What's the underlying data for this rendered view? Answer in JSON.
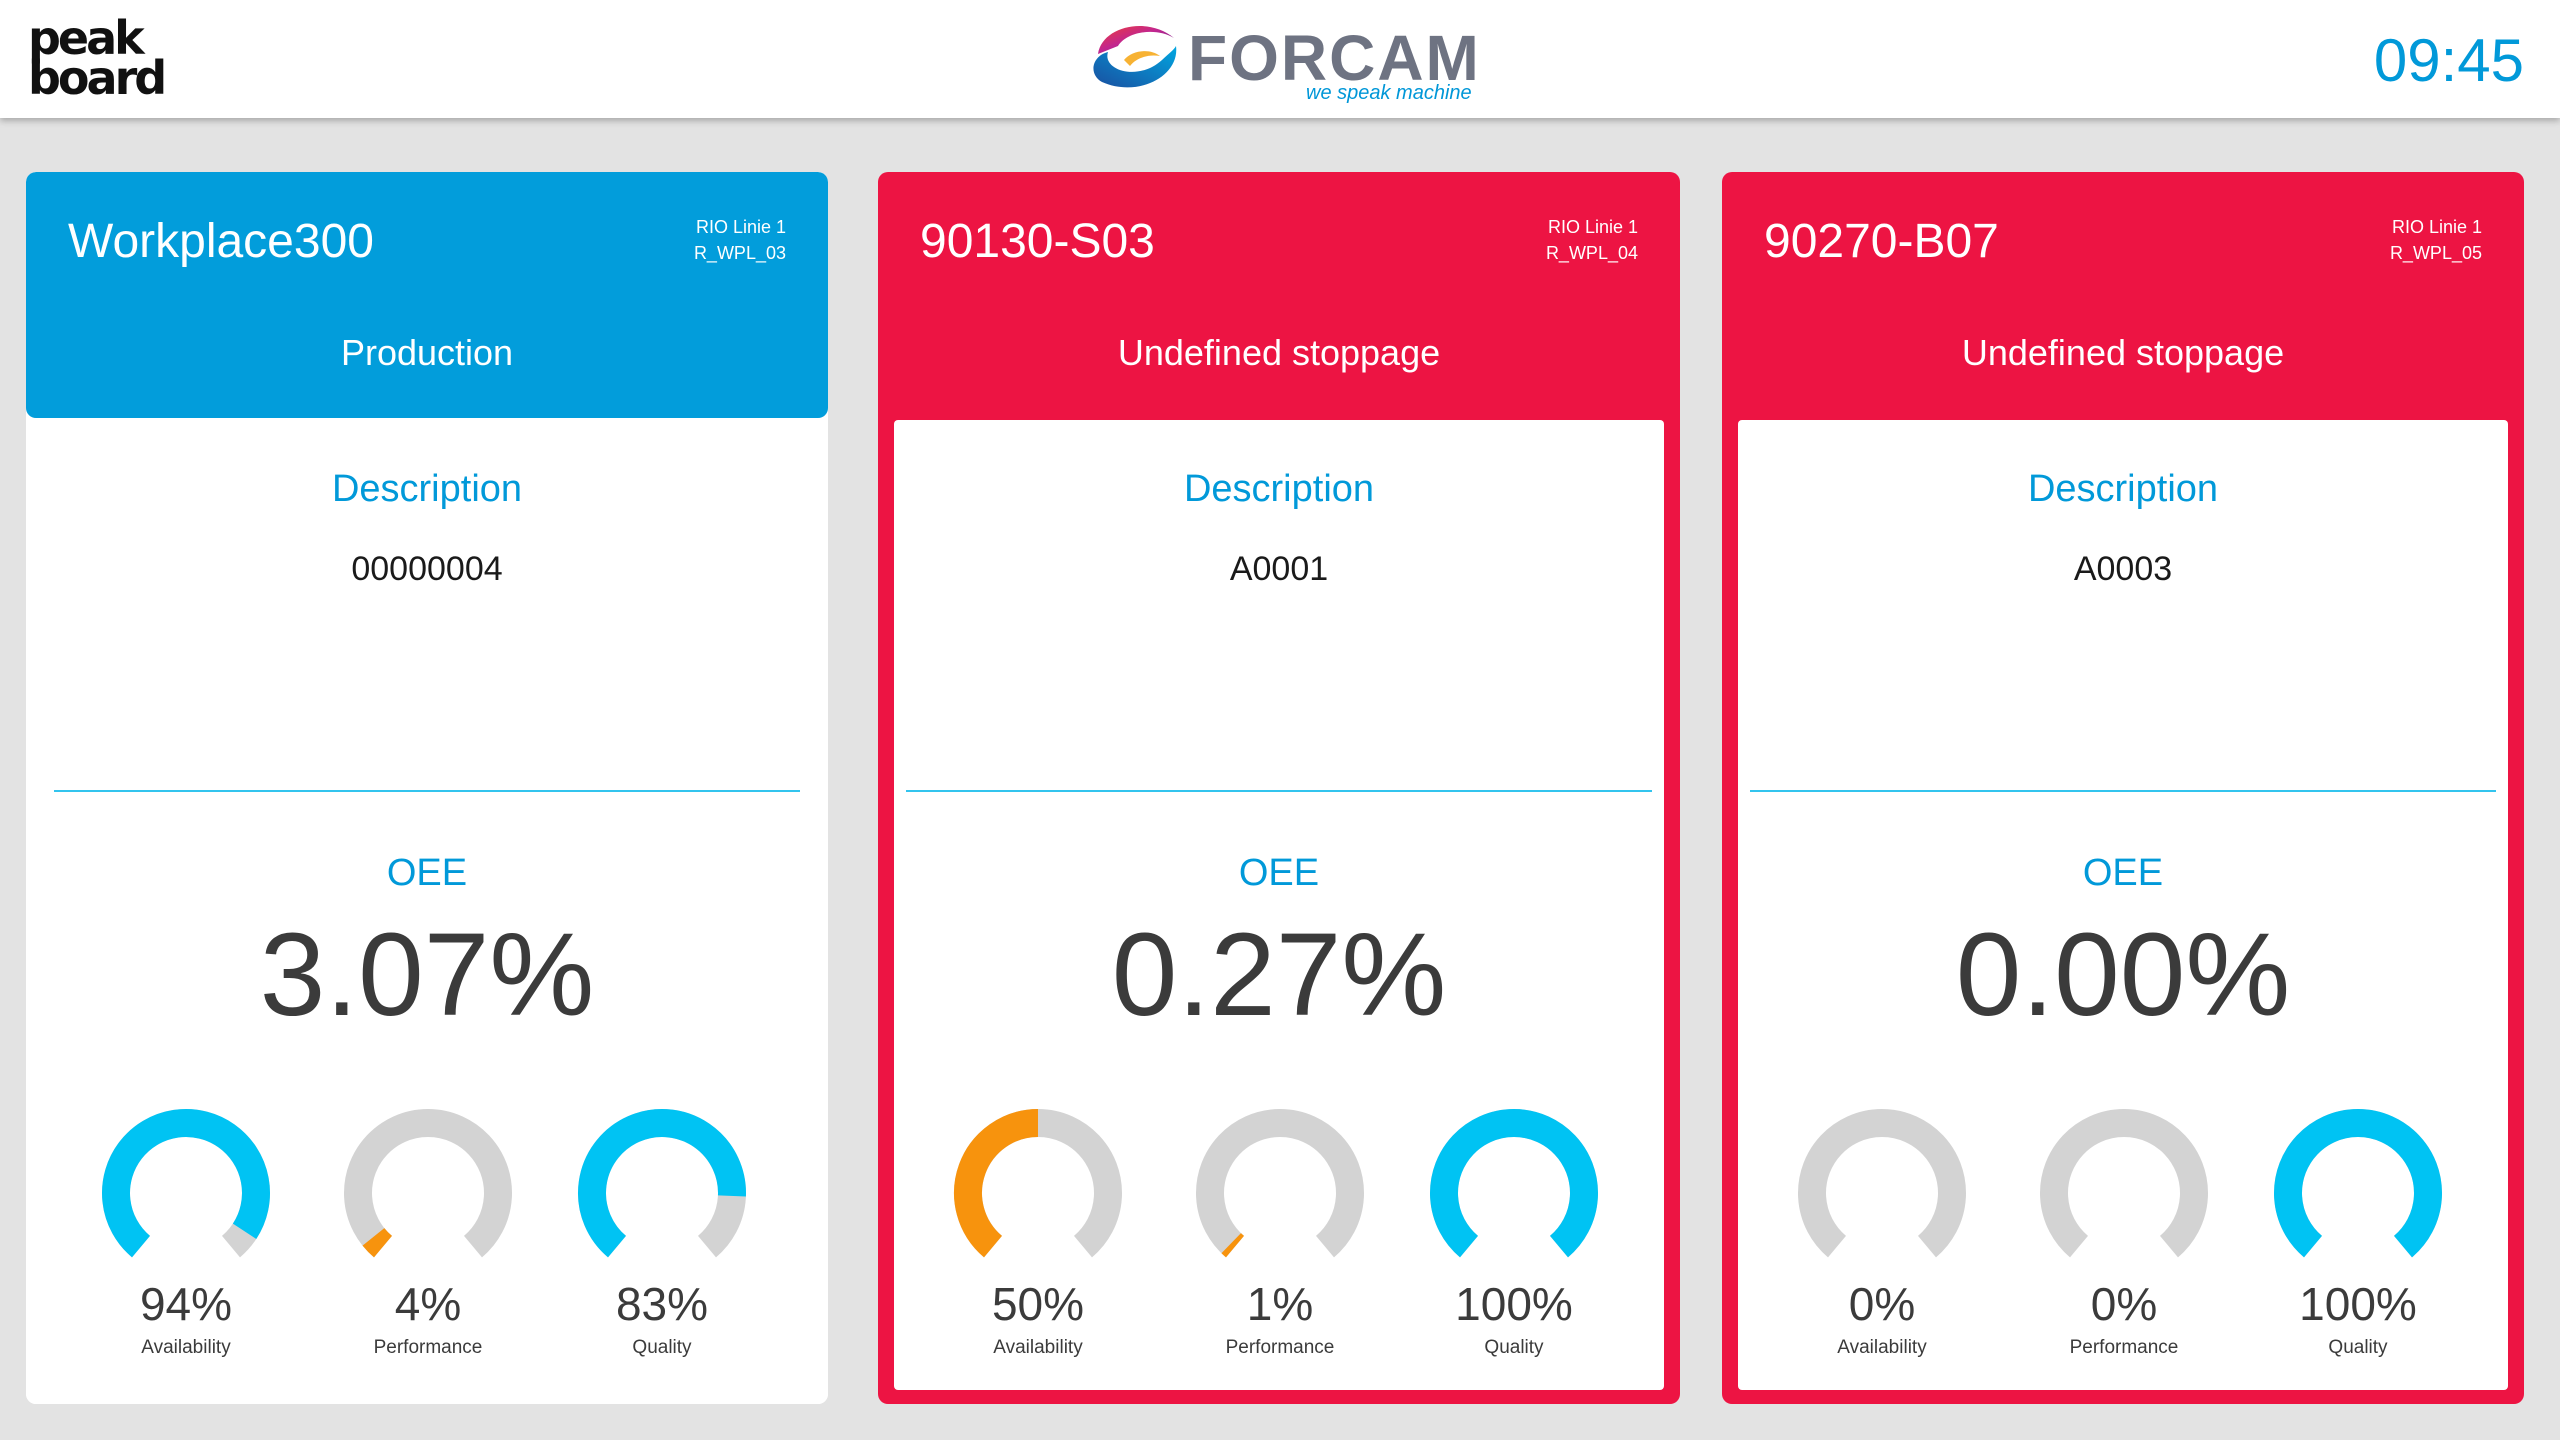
{
  "header": {
    "peakboard_logo": {
      "line1": "peak",
      "line2": "board"
    },
    "forcam_logo": {
      "wordmark": "FORCAM",
      "tagline": "we speak machine"
    },
    "clock": "09:45"
  },
  "colors": {
    "production": "#029ddb",
    "stoppage": "#ed1443",
    "accent_text": "#0199d9",
    "gauge_cyan": "#00c3f3",
    "gauge_orange": "#f7930d",
    "gauge_track": "#d3d3d3"
  },
  "cards": [
    {
      "title": "Workplace300",
      "meta_line1": "RIO Linie 1",
      "meta_line2": "R_WPL_03",
      "status": "Production",
      "state": "production",
      "description_label": "Description",
      "description_value": "00000004",
      "oee_label": "OEE",
      "oee_value": "3.07%",
      "gauges": [
        {
          "label": "Availability",
          "value_text": "94%",
          "value": 0.94,
          "color": "cyan"
        },
        {
          "label": "Performance",
          "value_text": "4%",
          "value": 0.04,
          "color": "orange"
        },
        {
          "label": "Quality",
          "value_text": "83%",
          "value": 0.83,
          "color": "cyan"
        }
      ]
    },
    {
      "title": "90130-S03",
      "meta_line1": "RIO Linie 1",
      "meta_line2": "R_WPL_04",
      "status": "Undefined stoppage",
      "state": "stoppage",
      "description_label": "Description",
      "description_value": "A0001",
      "oee_label": "OEE",
      "oee_value": "0.27%",
      "gauges": [
        {
          "label": "Availability",
          "value_text": "50%",
          "value": 0.5,
          "color": "orange"
        },
        {
          "label": "Performance",
          "value_text": "1%",
          "value": 0.01,
          "color": "orange"
        },
        {
          "label": "Quality",
          "value_text": "100%",
          "value": 1.0,
          "color": "cyan"
        }
      ]
    },
    {
      "title": "90270-B07",
      "meta_line1": "RIO Linie 1",
      "meta_line2": "R_WPL_05",
      "status": "Undefined stoppage",
      "state": "stoppage",
      "description_label": "Description",
      "description_value": "A0003",
      "oee_label": "OEE",
      "oee_value": "0.00%",
      "gauges": [
        {
          "label": "Availability",
          "value_text": "0%",
          "value": 0.0,
          "color": "orange"
        },
        {
          "label": "Performance",
          "value_text": "0%",
          "value": 0.0,
          "color": "orange"
        },
        {
          "label": "Quality",
          "value_text": "100%",
          "value": 1.0,
          "color": "cyan"
        }
      ]
    }
  ]
}
